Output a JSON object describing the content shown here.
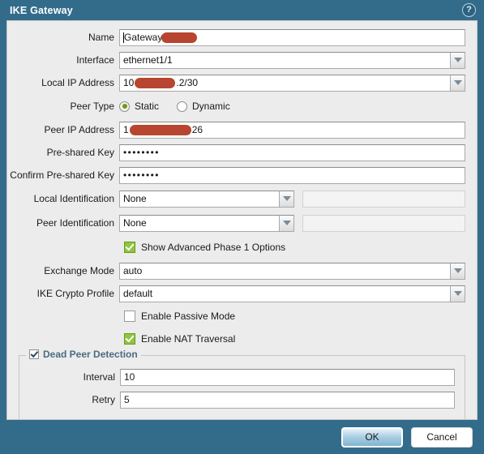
{
  "dialog": {
    "title": "IKE Gateway",
    "help_icon": "help-icon",
    "help_glyph": "?"
  },
  "form": {
    "name": {
      "label": "Name",
      "value_prefix": "Gateway",
      "redacted": true
    },
    "interface": {
      "label": "Interface",
      "value": "ethernet1/1"
    },
    "local_ip_address": {
      "label": "Local IP Address",
      "value_prefix": "10",
      "value_suffix": ".2/30",
      "redacted": true
    },
    "peer_type": {
      "label": "Peer Type",
      "selected": "Static",
      "options": [
        "Static",
        "Dynamic"
      ]
    },
    "peer_ip_address": {
      "label": "Peer IP Address",
      "value_prefix": "1",
      "value_suffix": "26",
      "redacted": true
    },
    "pre_shared_key": {
      "label": "Pre-shared Key",
      "value": "••••••••"
    },
    "confirm_pre_shared_key": {
      "label": "Confirm Pre-shared Key",
      "value": "••••••••"
    },
    "local_identification": {
      "label": "Local Identification",
      "value": "None",
      "secondary_value": ""
    },
    "peer_identification": {
      "label": "Peer Identification",
      "value": "None",
      "secondary_value": ""
    },
    "show_advanced": {
      "label": "Show Advanced Phase 1 Options",
      "checked": true
    },
    "exchange_mode": {
      "label": "Exchange Mode",
      "value": "auto"
    },
    "ike_crypto_profile": {
      "label": "IKE Crypto Profile",
      "value": "default"
    },
    "enable_passive_mode": {
      "label": "Enable Passive Mode",
      "checked": false
    },
    "enable_nat_traversal": {
      "label": "Enable NAT Traversal",
      "checked": true
    },
    "dead_peer_detection": {
      "legend": "Dead Peer Detection",
      "checked": true,
      "interval": {
        "label": "Interval",
        "value": "10"
      },
      "retry": {
        "label": "Retry",
        "value": "5"
      }
    }
  },
  "footer": {
    "ok_label": "OK",
    "cancel_label": "Cancel"
  },
  "colors": {
    "titlebar": "#336c8b",
    "panel": "#ececec",
    "accent_check": "#8dc63f",
    "radio_dot": "#6f9a16",
    "redaction": "#b8452f",
    "legend_text": "#4a6b80"
  }
}
